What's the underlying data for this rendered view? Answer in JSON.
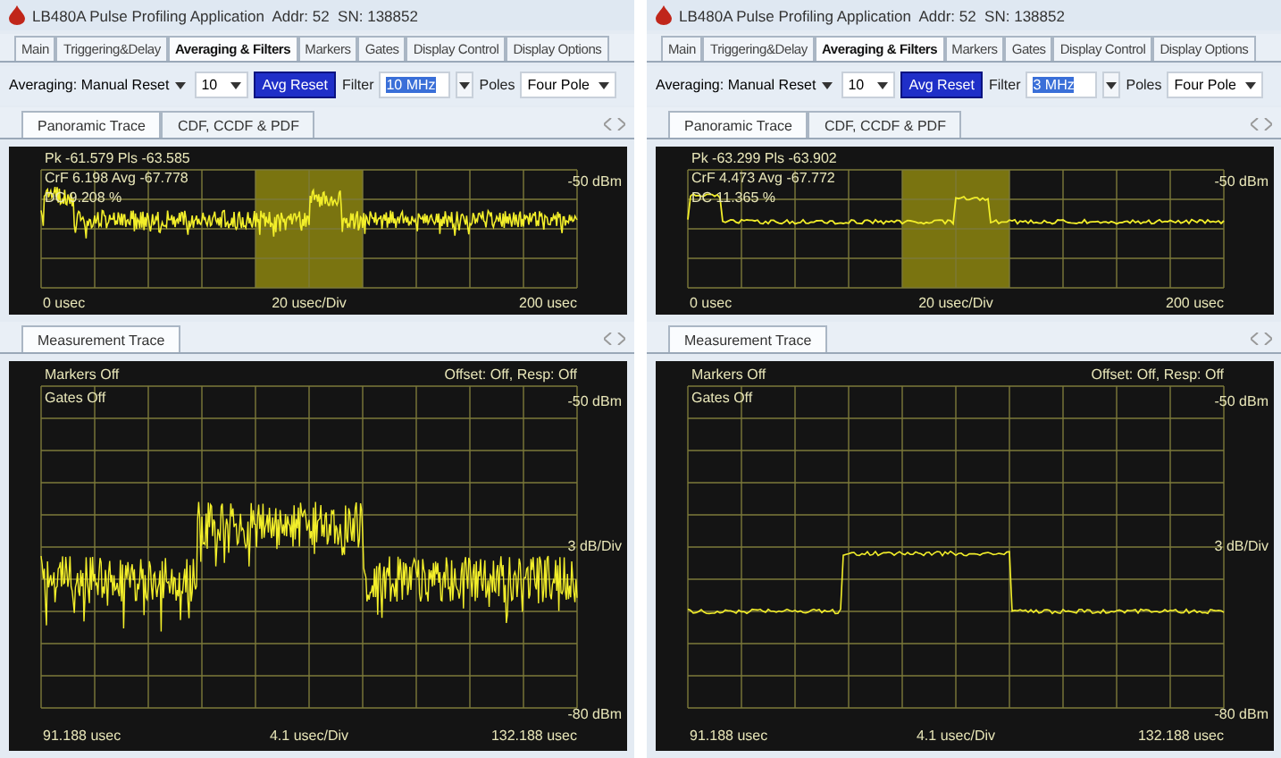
{
  "panels": [
    {
      "window": {
        "title": "LB480A Pulse Profiling Application  Addr: 52  SN: 138852"
      },
      "tabs": [
        {
          "label": "Main",
          "selected": false
        },
        {
          "label": "Triggering&Delay",
          "selected": false
        },
        {
          "label": "Averaging & Filters",
          "selected": true
        },
        {
          "label": "Markers",
          "selected": false
        },
        {
          "label": "Gates",
          "selected": false
        },
        {
          "label": "Display Control",
          "selected": false
        },
        {
          "label": "Display Options",
          "selected": false
        }
      ],
      "toolbar": {
        "averaging": "Averaging: Manual Reset",
        "count": "10",
        "avg_reset": "Avg Reset",
        "filter_label": "Filter",
        "filter_value": "10 MHz",
        "poles_label": "Poles",
        "poles": "Four Pole"
      },
      "subtabs": [
        {
          "label": "Panoramic Trace",
          "selected": true
        },
        {
          "label": "CDF, CCDF & PDF",
          "selected": false
        }
      ],
      "panoramic": {
        "readings": [
          "Pk -61.579  Pls -63.585",
          "CrF  6.198  Avg -67.778",
          "DC  9.208 %"
        ],
        "ref_level": "-50 dBm",
        "x_start": "0 usec",
        "x_scale": "20 usec/Div",
        "x_end": "200 usec",
        "noisy": true
      },
      "measurement_tab": {
        "label": "Measurement Trace"
      },
      "measurement": {
        "markers": "Markers Off",
        "gates": "Gates Off",
        "offset": "Offset: Off, Resp: Off",
        "top_level": "-50 dBm",
        "scale": "3 dB/Div",
        "bottom_level": "-80 dBm",
        "x_start": "91.188 usec",
        "x_scale": "4.1 usec/Div",
        "x_end": "132.188 usec",
        "noisy": true
      }
    },
    {
      "window": {
        "title": "LB480A Pulse Profiling Application  Addr: 52  SN: 138852"
      },
      "tabs": [
        {
          "label": "Main",
          "selected": false
        },
        {
          "label": "Triggering&Delay",
          "selected": false
        },
        {
          "label": "Averaging & Filters",
          "selected": true
        },
        {
          "label": "Markers",
          "selected": false
        },
        {
          "label": "Gates",
          "selected": false
        },
        {
          "label": "Display Control",
          "selected": false
        },
        {
          "label": "Display Options",
          "selected": false
        }
      ],
      "toolbar": {
        "averaging": "Averaging: Manual Reset",
        "count": "10",
        "avg_reset": "Avg Reset",
        "filter_label": "Filter",
        "filter_value": "3 MHz",
        "poles_label": "Poles",
        "poles": "Four Pole"
      },
      "subtabs": [
        {
          "label": "Panoramic Trace",
          "selected": true
        },
        {
          "label": "CDF, CCDF & PDF",
          "selected": false
        }
      ],
      "panoramic": {
        "readings": [
          "Pk -63.299  Pls -63.902",
          "CrF  4.473  Avg -67.772",
          "DC  11.365 %"
        ],
        "ref_level": "-50 dBm",
        "x_start": "0 usec",
        "x_scale": "20 usec/Div",
        "x_end": "200 usec",
        "noisy": false
      },
      "measurement_tab": {
        "label": "Measurement Trace"
      },
      "measurement": {
        "markers": "Markers Off",
        "gates": "Gates Off",
        "offset": "Offset: Off, Resp: Off",
        "top_level": "-50 dBm",
        "scale": "3 dB/Div",
        "bottom_level": "-80 dBm",
        "x_start": "91.188 usec",
        "x_scale": "4.1 usec/Div",
        "x_end": "132.188 usec",
        "noisy": false
      }
    }
  ]
}
